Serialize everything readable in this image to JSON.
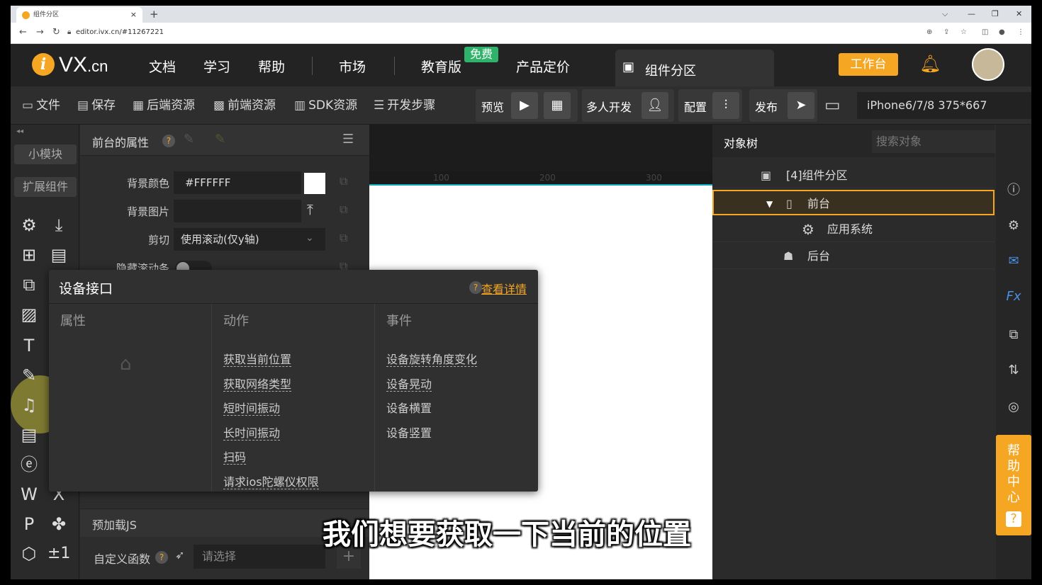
{
  "browser": {
    "tab_title": "组件分区",
    "url": "editor.ivx.cn/#11267221",
    "new_tab": "+",
    "close": "×"
  },
  "header": {
    "logo_letter": "i",
    "logo_text": "VX",
    "logo_suffix": ".cn",
    "nav": [
      "文档",
      "学习",
      "帮助",
      "市场",
      "教育版",
      "产品定价"
    ],
    "free_badge": "免费",
    "current_tab": "组件分区",
    "workbench_button": "工作台"
  },
  "toolbar": {
    "file": "文件",
    "save": "保存",
    "backend": "后端资源",
    "frontend": "前端资源",
    "sdk": "SDK资源",
    "steps": "开发步骤",
    "preview": "预览",
    "multi_dev": "多人开发",
    "config": "配置",
    "publish": "发布",
    "device": "iPhone6/7/8 375*667"
  },
  "left_rail": {
    "small_module": "小模块",
    "extend": "扩展组件",
    "pm_icon": "±1"
  },
  "props": {
    "title": "前台的属性",
    "bg_color_label": "背景颜色",
    "bg_color_value": "#FFFFFF",
    "bg_image_label": "背景图片",
    "clip_label": "剪切",
    "clip_value": "使用滚动(仅y轴)",
    "hide_scroll_label": "隐藏滚动条",
    "preload": "预加载JS",
    "custom_fn_label": "自定义函数",
    "custom_fn_placeholder": "请选择"
  },
  "canvas": {
    "ruler": [
      "100",
      "200",
      "300"
    ]
  },
  "tree": {
    "title": "对象树",
    "search_placeholder": "搜索对象",
    "nodes": [
      "[4]组件分区",
      "前台",
      "应用系统",
      "后台"
    ]
  },
  "popup": {
    "title": "设备接口",
    "more": "查看详情",
    "col_props": "属性",
    "col_actions": "动作",
    "col_events": "事件",
    "actions": [
      "获取当前位置",
      "获取网络类型",
      "短时间振动",
      "长时间振动",
      "扫码",
      "请求ios陀螺仪权限"
    ],
    "events": [
      "设备旋转角度变化",
      "设备晃动",
      "设备横置",
      "设备竖置"
    ]
  },
  "help_center": "帮助中心",
  "subtitle": "我们想要获取一下当前的位置",
  "colors": {
    "accent": "#f5a623",
    "free": "#2fb36b",
    "select_border": "#f5a623"
  }
}
